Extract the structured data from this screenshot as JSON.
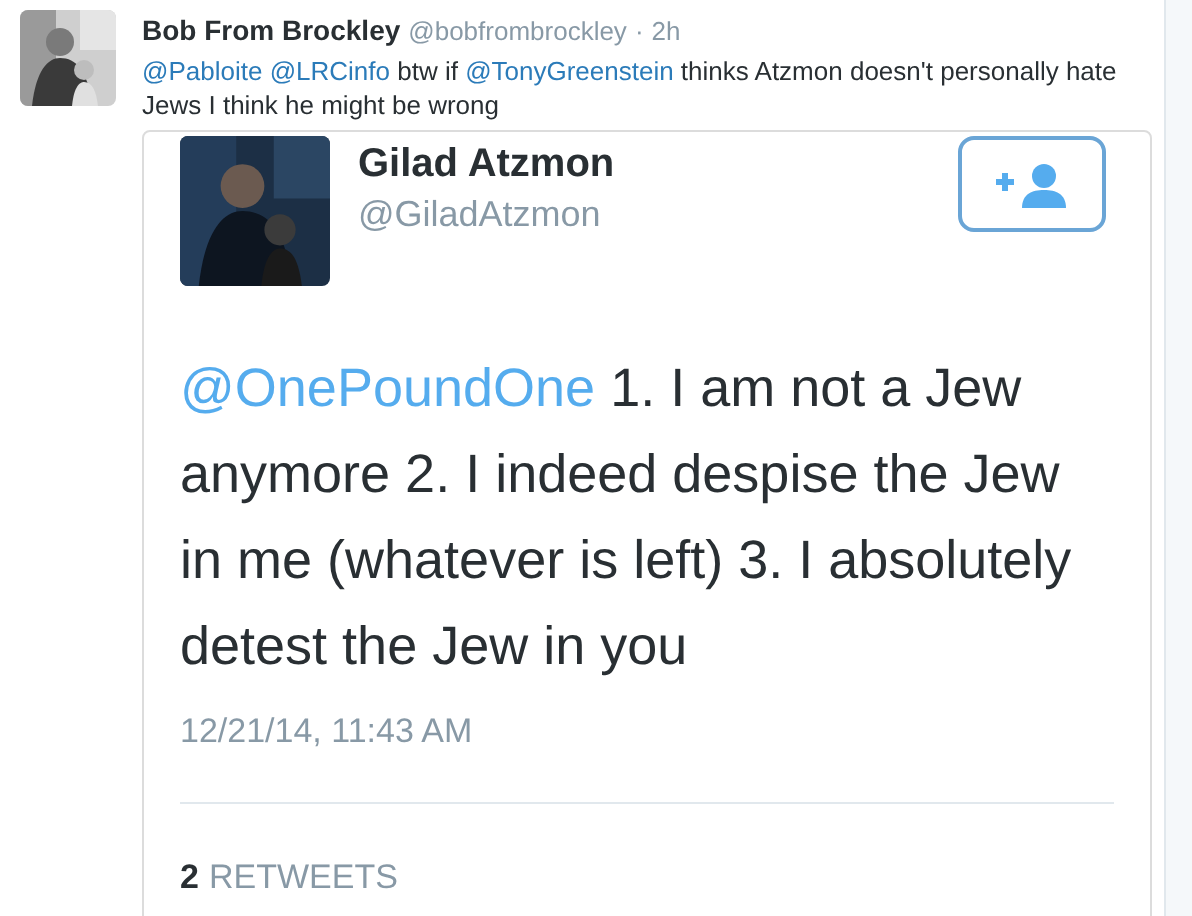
{
  "tweet": {
    "name": "Bob From Brockley",
    "handle": "@bobfrombrockley",
    "separator": "·",
    "time": "2h",
    "text": [
      {
        "kind": "mention",
        "text": "@Pabloite"
      },
      {
        "kind": "mention",
        "text": "@LRCinfo"
      },
      {
        "kind": "plain",
        "text": " btw if "
      },
      {
        "kind": "mention",
        "text": "@TonyGreenstein"
      },
      {
        "kind": "plain",
        "text": " thinks Atzmon doesn't personally hate Jews I think he might be wrong"
      }
    ]
  },
  "embedded": {
    "name": "Gilad Atzmon",
    "handle": "@GiladAtzmon",
    "text": [
      {
        "kind": "mention",
        "text": "@OnePoundOne"
      },
      {
        "kind": "plain",
        "text": " 1. I am not a Jew anymore 2. I indeed despise the Jew in me (whatever is left) 3. I absolutely detest the Jew in you"
      }
    ],
    "date": "12/21/14, 11:43 AM",
    "retweet_count": "2",
    "retweet_label": "RETWEETS"
  }
}
